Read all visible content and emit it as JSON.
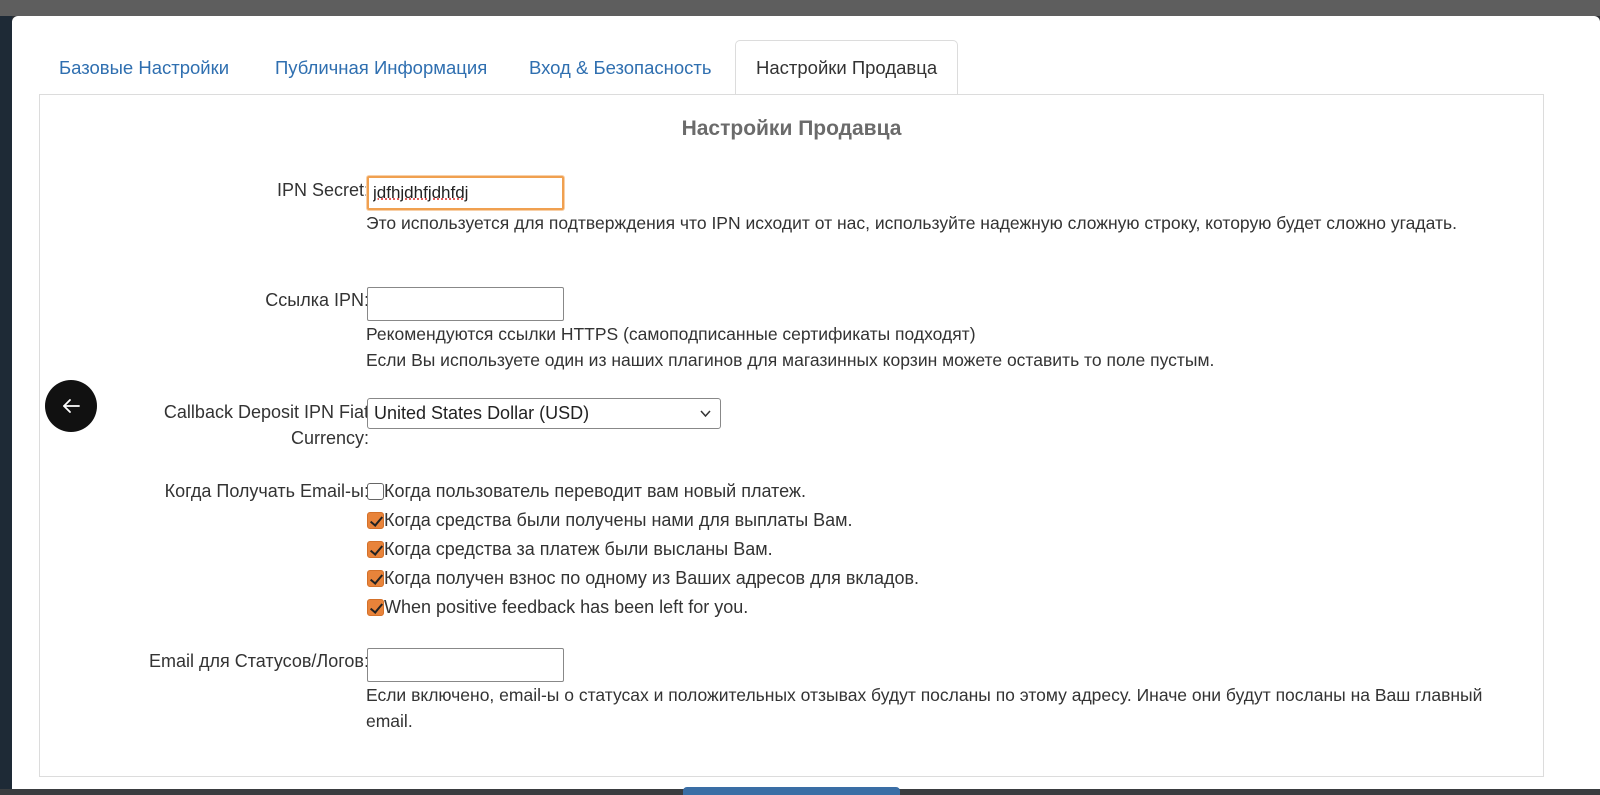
{
  "tabs": [
    {
      "label": "Базовые Настройки",
      "active": false
    },
    {
      "label": "Публичная Информация",
      "active": false
    },
    {
      "label": "Вход & Безопасность",
      "active": false
    },
    {
      "label": "Настройки Продавца",
      "active": true
    }
  ],
  "panel": {
    "title": "Настройки Продавца"
  },
  "ipn_secret": {
    "label": "IPN Secret:",
    "value": "jdfhjdhfjdhfdj",
    "help": "Это используется для подтверждения что IPN исходит от нас, используйте надежную сложную строку, которую будет сложно угадать."
  },
  "ipn_url": {
    "label": "Ссылка IPN:",
    "value": "",
    "help_1": "Рекомендуются ссылки HTTPS (самоподписанные сертификаты подходят)",
    "help_2": "Если Вы используете один из наших плагинов для магазинных корзин можете оставить то поле пустым."
  },
  "callback_currency": {
    "label_1": "Callback Deposit IPN Fiat",
    "label_2": "Currency:",
    "selected": "United States Dollar (USD)"
  },
  "emails": {
    "label": "Когда Получать Email-ы:",
    "options": [
      {
        "label": "Когда пользователь переводит вам новый платеж.",
        "checked": false
      },
      {
        "label": "Когда средства были получены нами для выплаты Вам.",
        "checked": true
      },
      {
        "label": "Когда средства за платеж были высланы Вам.",
        "checked": true
      },
      {
        "label": "Когда получен взнос по одному из Ваших адресов для вкладов.",
        "checked": true
      },
      {
        "label": "When positive feedback has been left for you.",
        "checked": true
      }
    ]
  },
  "status_email": {
    "label": "Email для Статусов/Логов:",
    "value": "",
    "help": "Если включено, email-ы о статусах и положительных отзывах будут посланы по этому адресу. Иначе они будут посланы на Ваш главный email."
  },
  "colors": {
    "accent": "#e8833a",
    "link": "#2f6fb0",
    "checkbox_fill": "#e8833a"
  },
  "icons": {
    "back": "arrow-left-icon",
    "select": "chevron-down-icon"
  }
}
